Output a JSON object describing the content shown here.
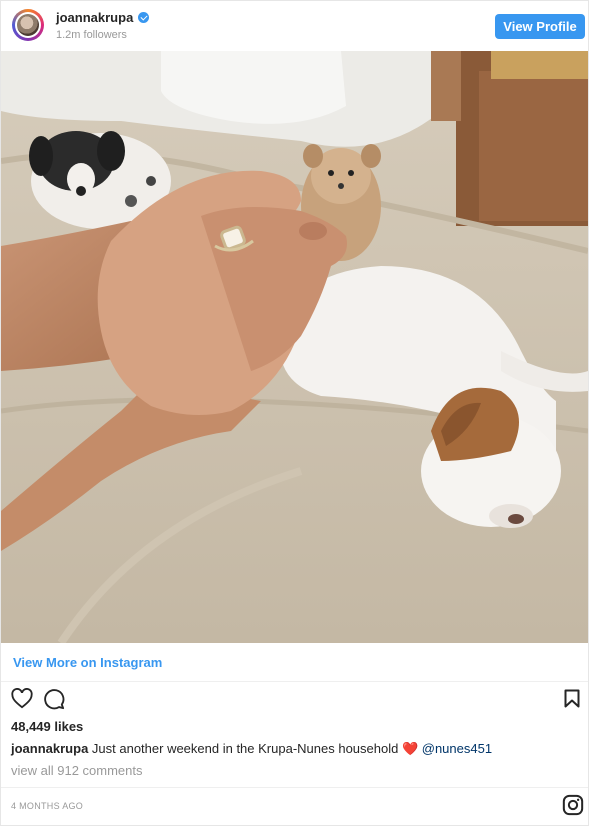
{
  "header": {
    "username": "joannakrupa",
    "followers": "1.2m followers",
    "view_profile_label": "View Profile"
  },
  "post": {
    "view_more_label": "View More on Instagram",
    "likes": "48,449 likes",
    "caption_user": "joannakrupa",
    "caption_text": " Just another weekend in the Krupa-Nunes household ❤️ ",
    "caption_mention": "@nunes451",
    "comments_label": "view all 912 comments",
    "timestamp": "4 MONTHS AGO"
  },
  "colors": {
    "accent": "#3897f0",
    "text": "#262626",
    "muted": "#999999"
  },
  "icons": [
    "heart-icon",
    "comment-icon",
    "bookmark-icon",
    "instagram-logo-icon",
    "verified-badge-icon"
  ]
}
